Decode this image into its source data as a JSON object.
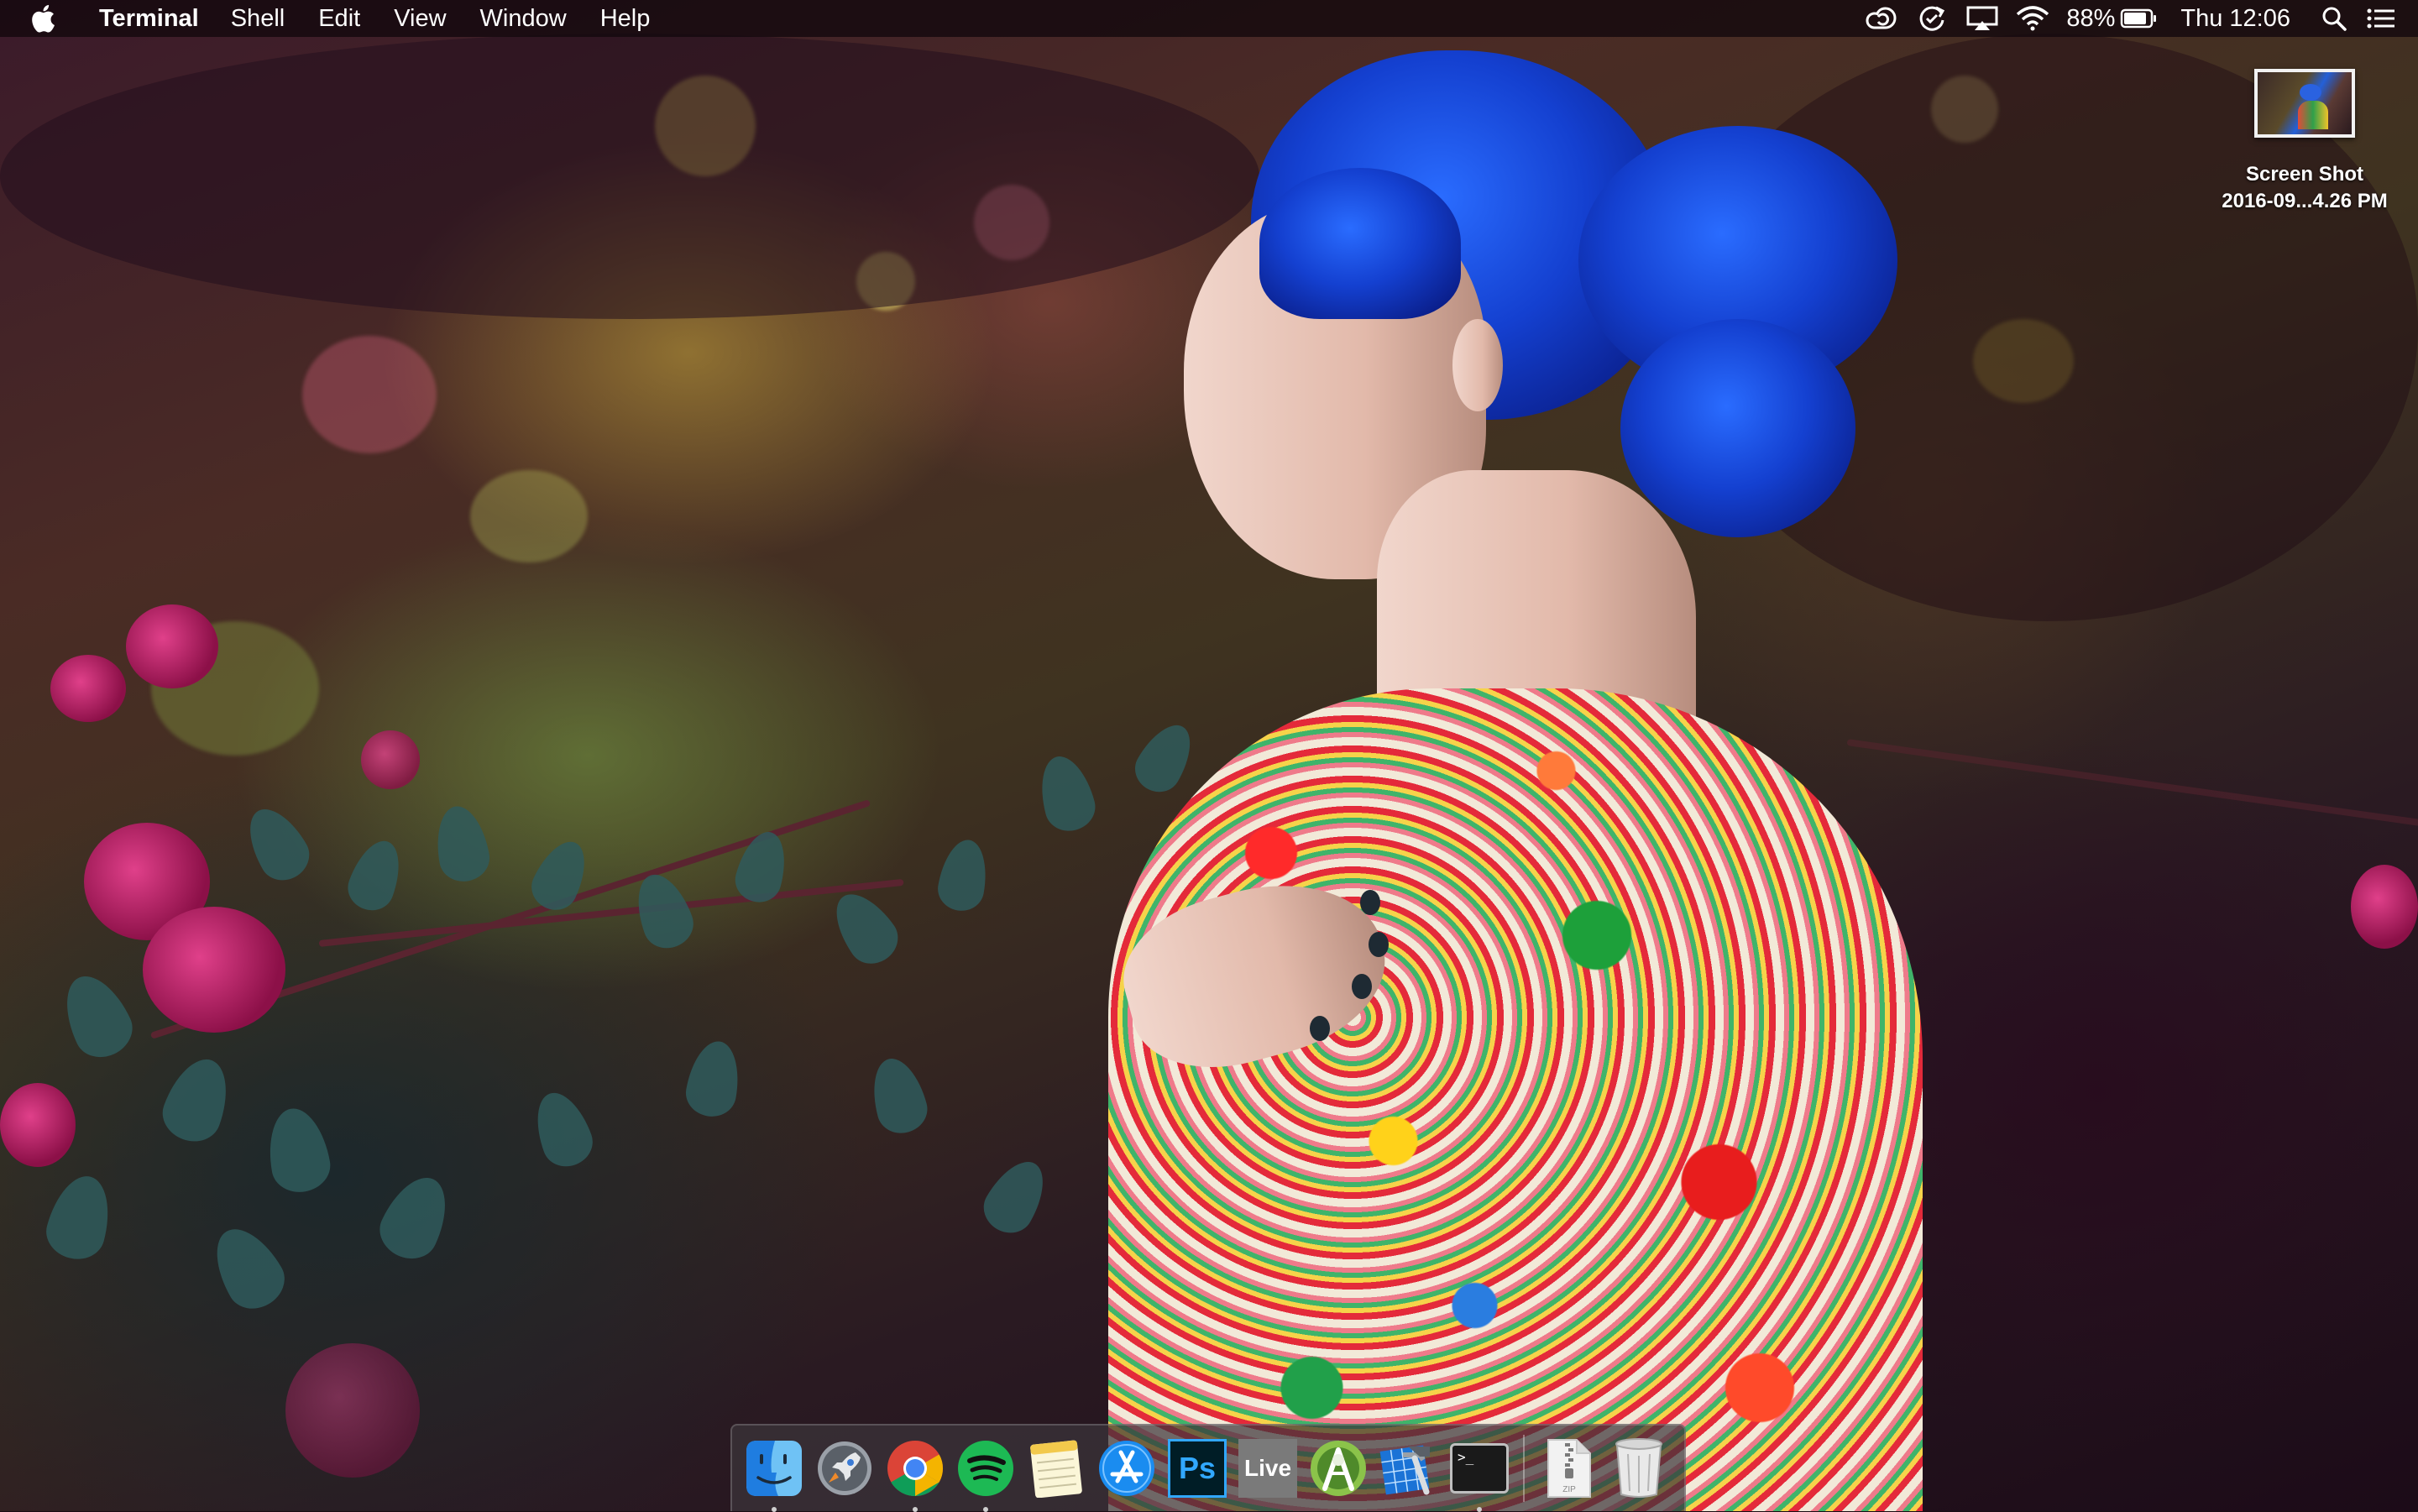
{
  "menubar": {
    "apple_icon": "apple-icon",
    "app_name": "Terminal",
    "menus": [
      "Shell",
      "Edit",
      "View",
      "Window",
      "Help"
    ],
    "status_icons": [
      "creative-cloud-icon",
      "sync-icon",
      "airplay-icon",
      "wifi-icon"
    ],
    "battery_percent": "88%",
    "battery_level": 0.88,
    "clock": "Thu 12:06",
    "spotlight_icon": "search-icon",
    "notification_icon": "notification-center-icon"
  },
  "desktop": {
    "file": {
      "name_line1": "Screen Shot",
      "name_line2": "2016-09...4.26 PM"
    }
  },
  "dock": {
    "apps": [
      {
        "name": "finder-icon",
        "running": true
      },
      {
        "name": "launchpad-icon",
        "running": false
      },
      {
        "name": "chrome-icon",
        "running": true
      },
      {
        "name": "spotify-icon",
        "running": true
      },
      {
        "name": "notes-icon",
        "running": false
      },
      {
        "name": "app-store-icon",
        "running": false
      },
      {
        "name": "photoshop-icon",
        "label": "Ps",
        "running": false
      },
      {
        "name": "ableton-live-icon",
        "label": "Live",
        "running": false
      },
      {
        "name": "android-studio-icon",
        "running": false
      },
      {
        "name": "xcode-icon",
        "running": false
      },
      {
        "name": "terminal-icon",
        "label": ">_",
        "running": true
      }
    ],
    "others": [
      {
        "name": "zip-archive-icon",
        "label": "ZIP"
      },
      {
        "name": "trash-icon"
      }
    ]
  },
  "colors": {
    "menubar_bg": "#14080e",
    "hair": "#1440d0",
    "photoshop": "#31a8ff",
    "spotify": "#1db954"
  }
}
